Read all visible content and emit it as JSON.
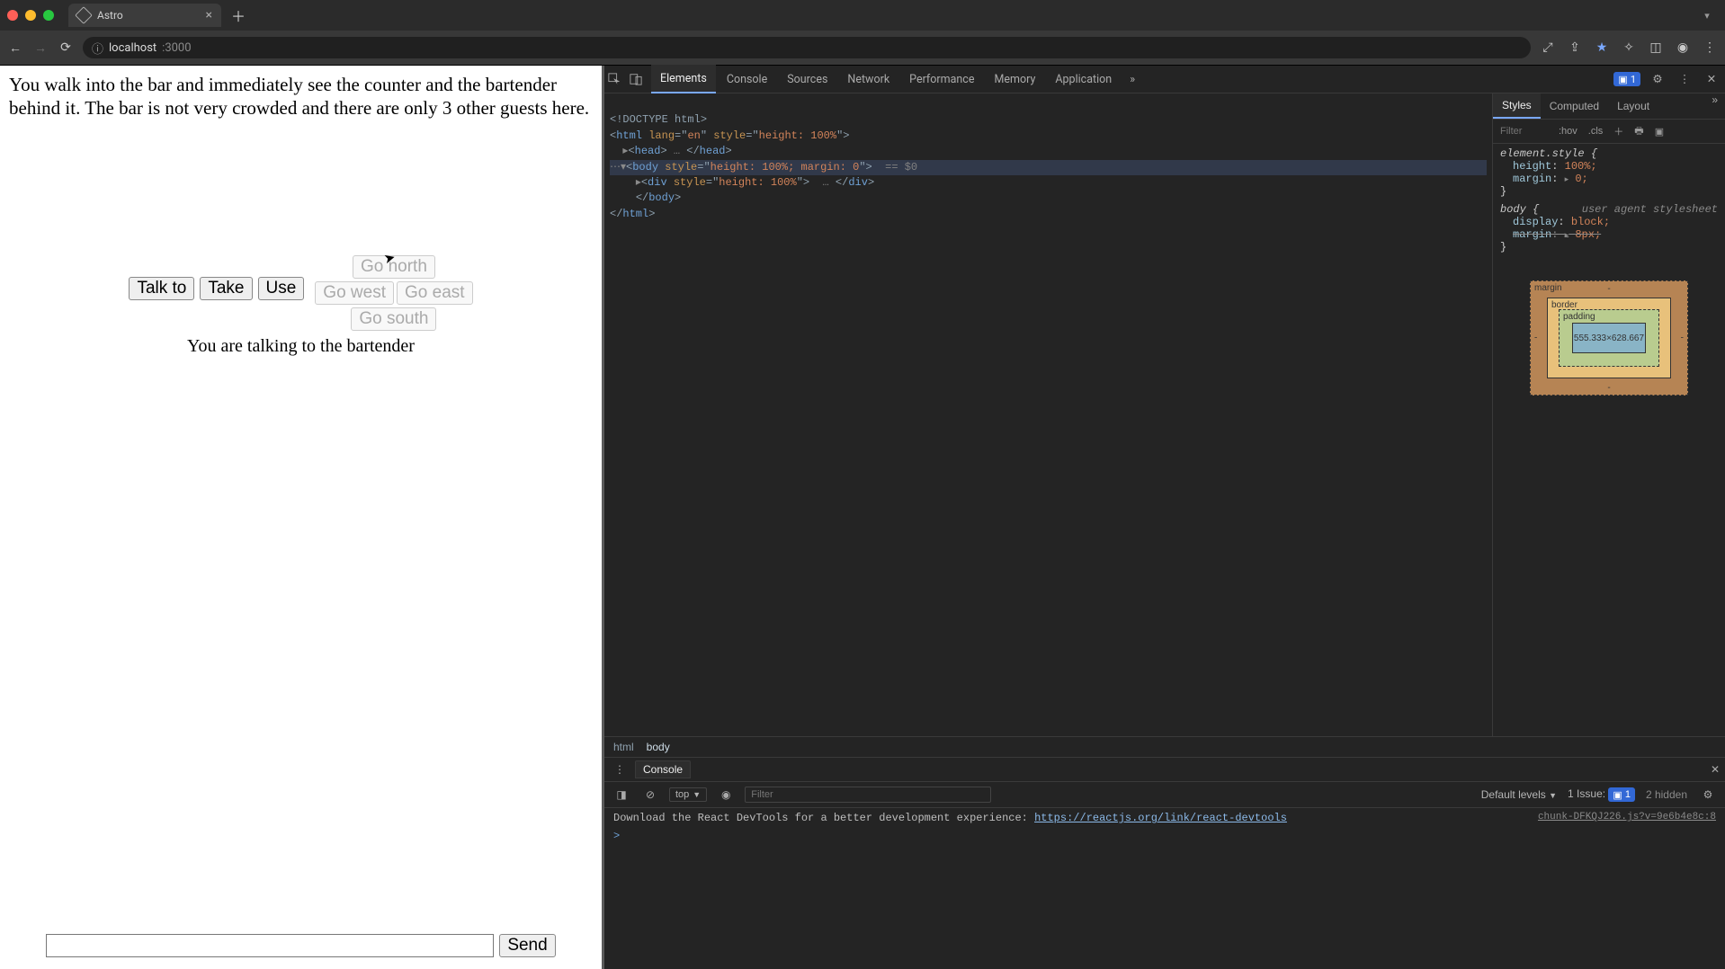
{
  "browser": {
    "tab_title": "Astro",
    "url_host": "localhost",
    "url_port": ":3000"
  },
  "game": {
    "narrative": "You walk into the bar and immediately see the counter and the bartender behind it. The bar is not very crowded and there are only 3 other guests here.",
    "actions": {
      "talk": "Talk to",
      "take": "Take",
      "use": "Use"
    },
    "dirs": {
      "north": "Go north",
      "west": "Go west",
      "east": "Go east",
      "south": "Go south"
    },
    "status": "You are talking to the bartender",
    "send": "Send"
  },
  "devtools": {
    "tabs": [
      "Elements",
      "Console",
      "Sources",
      "Network",
      "Performance",
      "Memory",
      "Application"
    ],
    "issues_badge": "1",
    "styles_tabs": [
      "Styles",
      "Computed",
      "Layout"
    ],
    "filter_placeholder": "Filter",
    "hov": ":hov",
    "cls": ".cls",
    "dom": {
      "l1": "<!DOCTYPE html>",
      "l2a": "<",
      "l2b": "html",
      "l2c": " lang",
      "l2d": "=\"",
      "l2e": "en",
      "l2f": "\" ",
      "l2g": "style",
      "l2h": "=\"",
      "l2i": "height: 100%",
      "l2j": "\">",
      "l3a": "<",
      "l3b": "head",
      "l3c": ">",
      "l3d": " … ",
      "l3e": "</",
      "l3f": "head",
      "l3g": ">",
      "l4a": "<",
      "l4b": "body",
      "l4c": " style",
      "l4d": "=\"",
      "l4e": "height: 100%; margin: 0",
      "l4f": "\"> ",
      "l4g": "== $0",
      "l5a": "<",
      "l5b": "div",
      "l5c": " style",
      "l5d": "=\"",
      "l5e": "height: 100%",
      "l5f": "\"> ",
      "l5g": " … ",
      "l5h": "</",
      "l5i": "div",
      "l5j": ">",
      "l6a": "</",
      "l6b": "body",
      "l6c": ">",
      "l7a": "</",
      "l7b": "html",
      "l7c": ">"
    },
    "rules": {
      "es_sel": "element.style {",
      "p1n": "height",
      "p1v": "100%;",
      "p2n": "margin",
      "p2v": "0;",
      "close": "}",
      "body_sel": "body {",
      "ua": "user agent stylesheet",
      "p3n": "display",
      "p3v": "block;",
      "p4n": "margin",
      "p4v": "8px;"
    },
    "boxmodel": {
      "margin": "margin",
      "border": "border",
      "padding": "padding",
      "content": "555.333×628.667",
      "dash": "-"
    },
    "crumb": {
      "html": "html",
      "body": "body"
    }
  },
  "console": {
    "tab": "Console",
    "context": "top",
    "filter_placeholder": "Filter",
    "levels": "Default levels",
    "issue_label": "1 Issue:",
    "issue_count": "1",
    "hidden": "2 hidden",
    "log_src": "chunk-DFKQJ226.js?v=9e6b4e8c:8",
    "log_msg": "Download the React DevTools for a better development experience: ",
    "log_link": "https://reactjs.org/link/react-devtools",
    "prompt": ">"
  }
}
